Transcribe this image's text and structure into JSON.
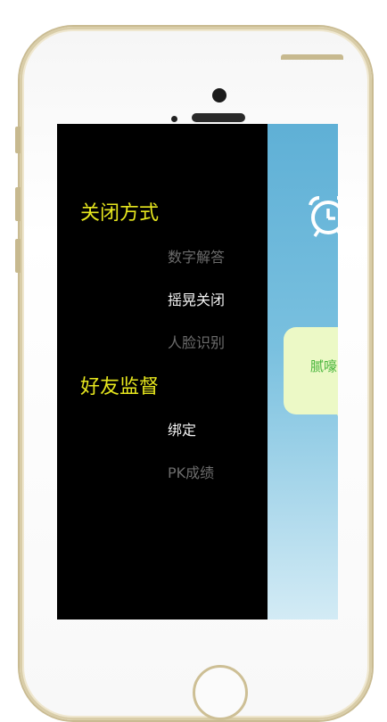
{
  "menu": {
    "close_method": {
      "header": "关闭方式",
      "items": [
        {
          "label": "数字解答",
          "active": false
        },
        {
          "label": "摇晃关闭",
          "active": true
        },
        {
          "label": "人脸识别",
          "active": false
        }
      ]
    },
    "friend_supervision": {
      "header": "好友监督",
      "items": [
        {
          "label": "绑定",
          "active": true
        },
        {
          "label": "PK成绩",
          "active": false
        }
      ]
    }
  },
  "main": {
    "icon": "alarm-clock-icon",
    "bubble_text": "腻嚎"
  },
  "colors": {
    "header": "#e6e61e",
    "active_item": "#f2f2f2",
    "inactive_item": "#6c6c6c",
    "bubble_bg": "#ecf9c6",
    "bubble_text": "#46b43a",
    "panel_top": "#5fb0d6"
  }
}
